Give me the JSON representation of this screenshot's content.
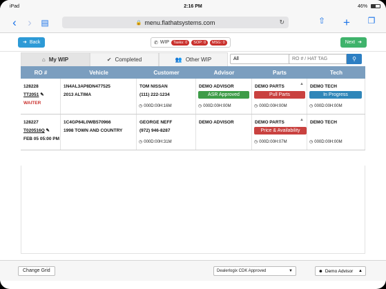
{
  "status_bar": {
    "device": "iPad",
    "time": "2:16 PM",
    "battery": "46%"
  },
  "browser": {
    "url": "menu.flathatsystems.com"
  },
  "header": {
    "back_label": "Back",
    "next_label": "Next",
    "wip_label": "WIP",
    "tasks_badge": "Tasks: 0",
    "sop_badge": "SOP: 0",
    "msg_badge": "MSG: 0"
  },
  "tabs": [
    {
      "label": "My WIP"
    },
    {
      "label": "Completed"
    },
    {
      "label": "Other WIP"
    }
  ],
  "filter": {
    "selected": "All"
  },
  "search": {
    "placeholder": "RO # / HAT TAG"
  },
  "table": {
    "columns": [
      "RO #",
      "Vehicle",
      "Customer",
      "Advisor",
      "Parts",
      "Tech"
    ],
    "rows": [
      {
        "ro": "128228",
        "tag": "TT2051",
        "note": "WAITER",
        "vin": "1N4AL3AP8DN477525",
        "vehicle": "2013 ALTIMA",
        "customer": "TOM NISSAN",
        "phone": "(111) 222-1234",
        "customer_timer": "000D:00H:16M",
        "advisor": "DEMO ADVISOR",
        "advisor_status": "ASR Approved",
        "advisor_timer": "000D:00H:00M",
        "parts": "DEMO PARTS",
        "parts_status": "Pull Parts",
        "parts_timer": "000D:00H:00M",
        "tech": "DEMO TECH",
        "tech_status": "In Progress",
        "tech_timer": "000D:00H:00M"
      },
      {
        "ro": "128227",
        "tag": "T020516Q",
        "note": "FEB 05 05:00 PM",
        "vin": "1C4GP64L0WB570966",
        "vehicle": "1998 TOWN AND COUNTRY",
        "customer": "GEORGE NEFF",
        "phone": "(972) 946-8287",
        "customer_timer": "000D:00H:31M",
        "advisor": "DEMO ADVISOR",
        "parts": "DEMO PARTS",
        "parts_status": "Price & Availability",
        "parts_timer": "000D:00H:07M",
        "tech": "DEMO TECH",
        "tech_timer": "000D:00H:00M"
      }
    ]
  },
  "footer": {
    "change_grid_label": "Change Grid",
    "provider_selected": "Dealerlogix CDK Approved",
    "user_label": "Demo Advisor"
  },
  "colors": {
    "header_blue": "#7b9ebf",
    "approved_green": "#3e9c48",
    "alert_red": "#c9413f",
    "progress_blue": "#2f86b9"
  }
}
